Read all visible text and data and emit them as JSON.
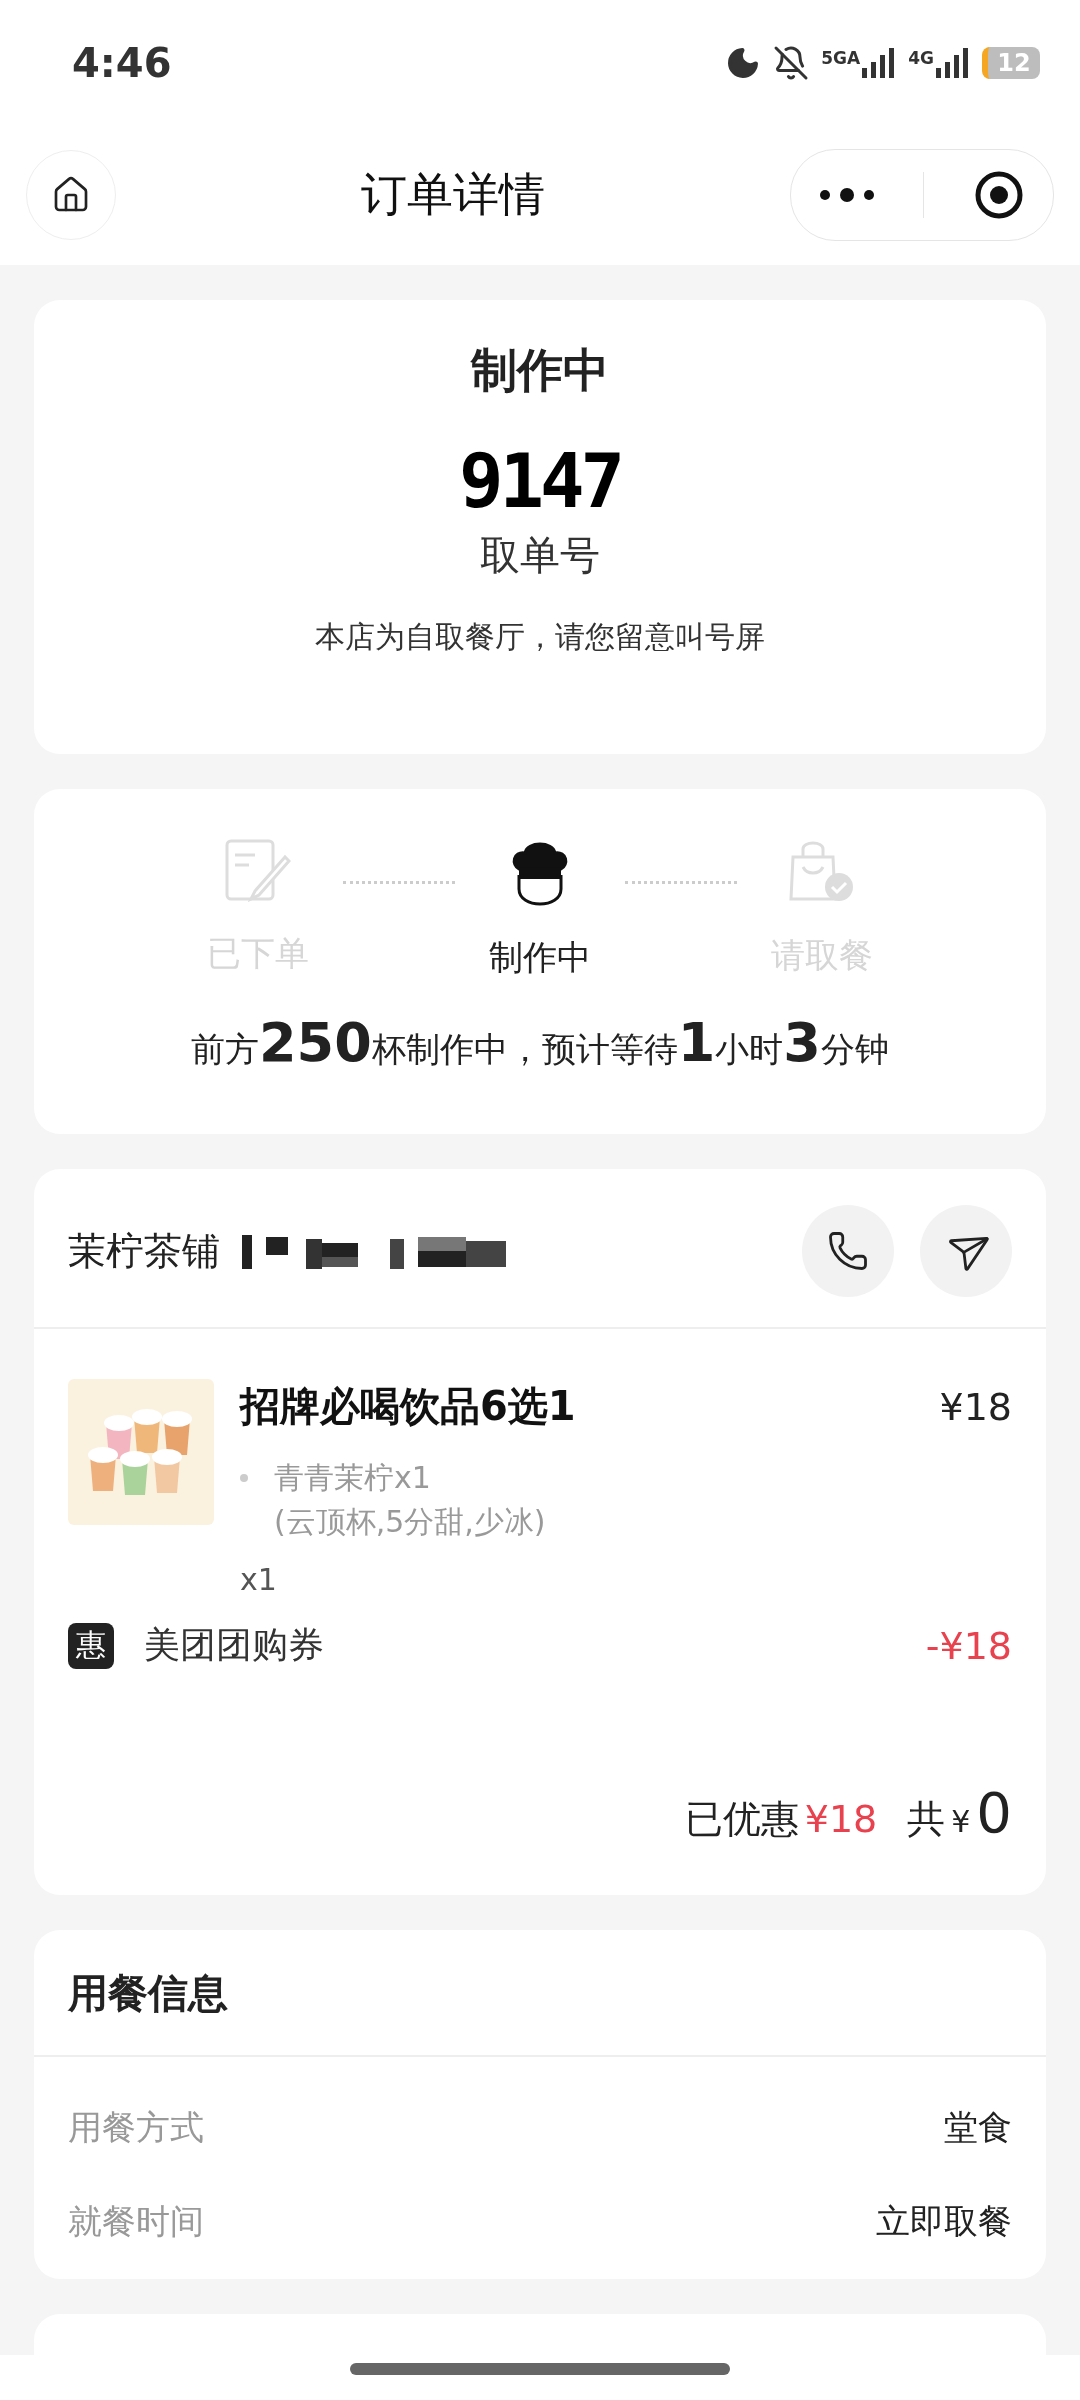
{
  "status_bar": {
    "time": "4:46",
    "network_1": "5GA",
    "network_2": "4G",
    "battery": "12"
  },
  "nav": {
    "title": "订单详情"
  },
  "status_card": {
    "status": "制作中",
    "pickup_number": "9147",
    "pickup_label": "取单号",
    "notice": "本店为自取餐厅，请您留意叫号屏"
  },
  "progress": {
    "steps": [
      {
        "kind": "order",
        "label": "已下单",
        "selected": false
      },
      {
        "kind": "cooking",
        "label": "制作中",
        "selected": true
      },
      {
        "kind": "pickup",
        "label": "请取餐",
        "selected": false
      }
    ],
    "message": "前方**250**杯制作中，预计等待**1**小时**3**分钟"
  },
  "store": {
    "name": "茉柠茶铺",
    "items": [
      {
        "kind": "picture",
        "title": "招牌必喝饮品6选1",
        "price": "¥18",
        "option": "青青茉柠x1",
        "option_detail": "(云顶杯,5分甜,少冰)",
        "quantity": "x1"
      }
    ],
    "discount": {
      "badge": "惠",
      "label": "美团团购券",
      "amount": "-¥18"
    },
    "saved_label": "已优惠",
    "saved_amount": "¥18",
    "total_label": "共",
    "total_currency": "¥",
    "total": "0"
  },
  "dining_info": {
    "title": "用餐信息",
    "rows": [
      {
        "label": "用餐方式",
        "value": "堂食"
      },
      {
        "label": "就餐时间",
        "value": "立即取餐"
      }
    ]
  }
}
